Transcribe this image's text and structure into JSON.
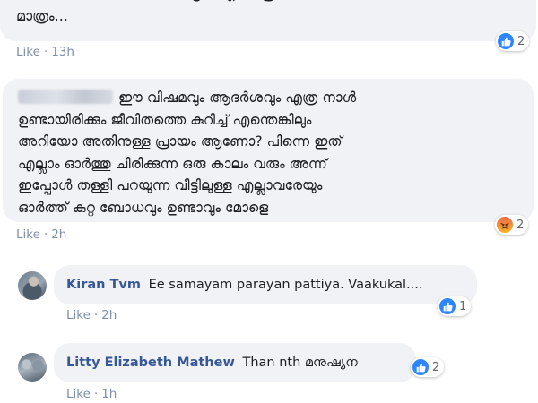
{
  "comments": {
    "top": {
      "text": "ജീവിക്കാൻ നിനക്കു കഴിയട്ടെ... എന്ന് പ്രാർത്ഥന\nമാത്രം...",
      "like_label": "Like",
      "time": "13h",
      "reaction": {
        "icon": "like-icon",
        "count": "2"
      }
    },
    "main": {
      "text": "ഈ വിഷമവും ആദർശവും എത്ര നാൾ\nഉണ്ടായിരിക്കും ജീവിതത്തെ കുറിച്ച് എന്തെങ്കിലും\nഅറിയോ അതിനുള്ള പ്രായം ആണോ? പിന്നെ ഇത്\nഎല്ലാം ഓർത്തു ചിരിക്കുന്ന ഒരു കാലം വരും അന്ന്\nഇപ്പോൾ തള്ളി പറയുന്ന വീട്ടിലുള്ള എല്ലാവരേയും\nഓർത്ത് കുറ്റ ബോധവും ഉണ്ടാവും മോളെ",
      "like_label": "Like",
      "time": "2h",
      "reaction": {
        "icon": "angry-icon",
        "count": "2"
      }
    }
  },
  "replies": [
    {
      "author": "Kiran Tvm",
      "text": "Ee samayam parayan pattiya. Vaakukal....",
      "like_label": "Like",
      "time": "2h",
      "reaction": {
        "icon": "like-icon",
        "count": "1"
      }
    },
    {
      "author": "Litty Elizabeth Mathew",
      "text": "Than nth മനുഷ്യന",
      "like_label": "Like",
      "time": "1h",
      "reaction": {
        "icon": "like-icon",
        "count": "2"
      }
    }
  ],
  "colors": {
    "bubble": "#f0f2f5",
    "author": "#365899",
    "meta": "#7f8fa8",
    "like_blue": "#2d86ff"
  }
}
